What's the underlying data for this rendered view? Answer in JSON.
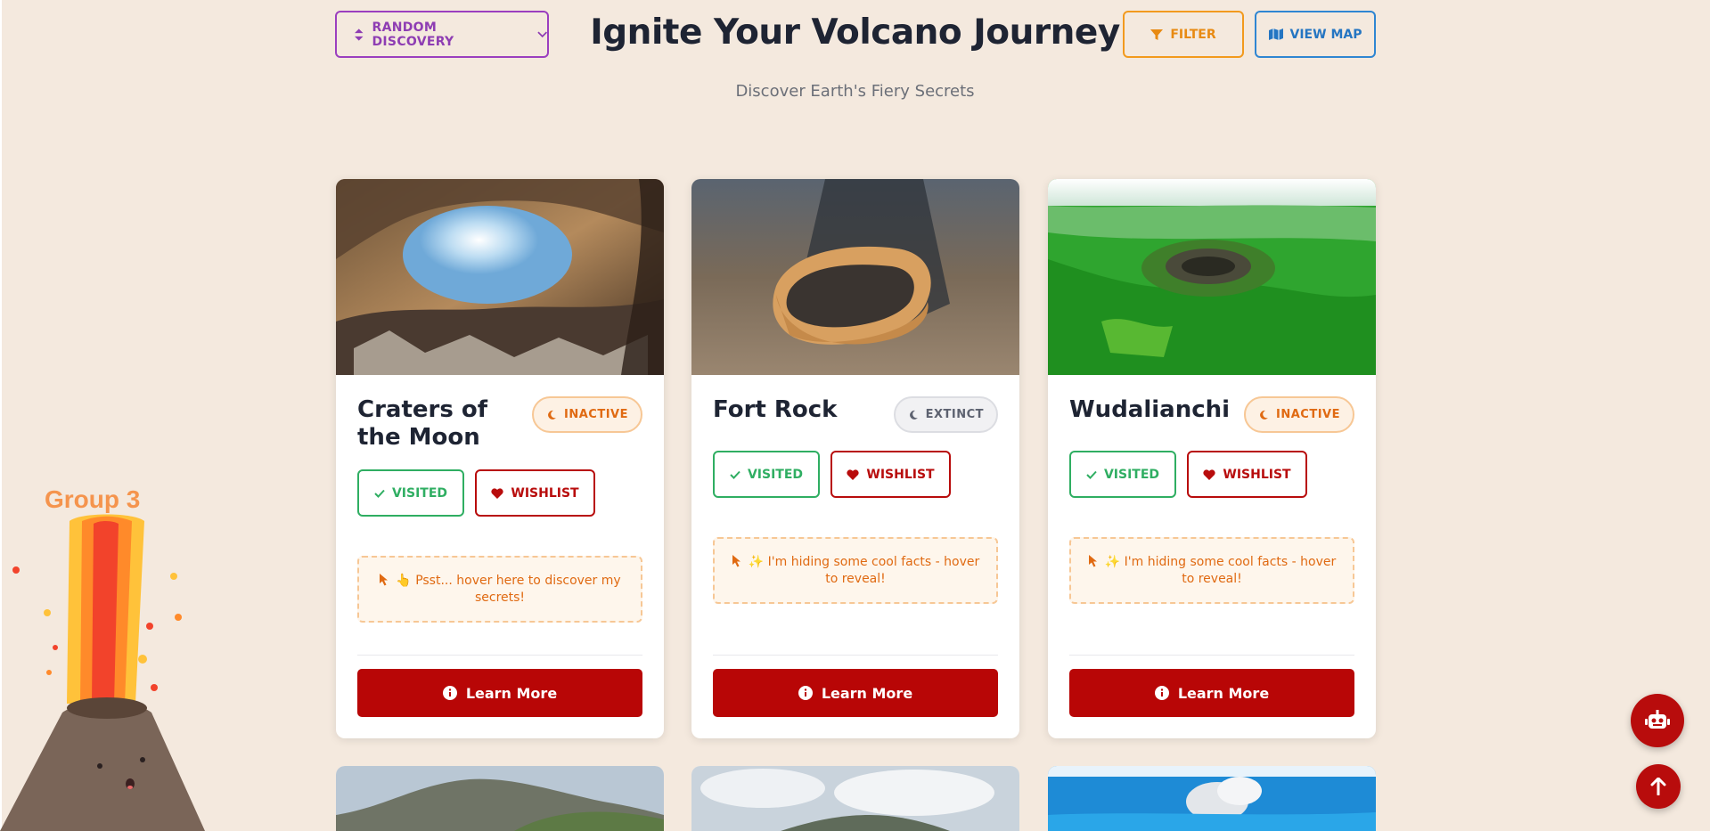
{
  "header": {
    "title": "Ignite Your Volcano Journey",
    "subtitle": "Discover Earth's Fiery Secrets",
    "random_label": "RANDOM DISCOVERY",
    "filter_label": "FILTER",
    "map_label": "VIEW MAP"
  },
  "cards": [
    {
      "title": "Craters of the Moon",
      "status": "INACTIVE",
      "visited_label": "VISITED",
      "wishlist_label": "WISHLIST",
      "hint": "👆 Psst... hover here to discover my secrets!",
      "learn_label": "Learn More"
    },
    {
      "title": "Fort Rock",
      "status": "EXTINCT",
      "visited_label": "VISITED",
      "wishlist_label": "WISHLIST",
      "hint": "✨ I'm hiding some cool facts - hover to reveal!",
      "learn_label": "Learn More"
    },
    {
      "title": "Wudalianchi",
      "status": "INACTIVE",
      "visited_label": "VISITED",
      "wishlist_label": "WISHLIST",
      "hint": "✨ I'm hiding some cool facts - hover to reveal!",
      "learn_label": "Learn More"
    }
  ],
  "mascot": {
    "label": "Group 3"
  },
  "icons": {
    "sort": "sort-icon",
    "chevron": "chevron-down-icon",
    "filter": "filter-icon",
    "map": "map-icon",
    "moon": "moon-icon",
    "check": "check-icon",
    "heart": "heart-icon",
    "pointer": "pointer-icon",
    "info": "info-icon",
    "robot": "robot-icon",
    "arrow_up": "arrow-up-icon"
  },
  "colors": {
    "background": "#f4e9de",
    "accent_red": "#b80606",
    "inactive_orange": "#e06a12",
    "visited_green": "#2fae62",
    "filter_orange": "#f29a1e",
    "map_blue": "#2f86d2",
    "random_purple": "#9b3fbf"
  }
}
